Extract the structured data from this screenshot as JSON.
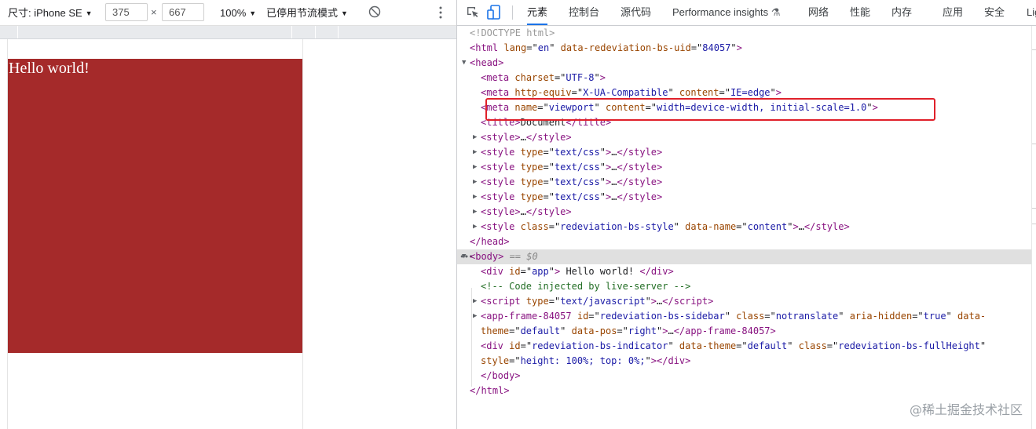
{
  "device_toolbar": {
    "dimensions_label": "尺寸: iPhone SE",
    "width_value": "375",
    "times_sign": "×",
    "height_value": "667",
    "zoom_label": "100%",
    "throttling_label": "已停用节流模式"
  },
  "page_preview": {
    "app_text": "Hello world!",
    "app_background": "#a52a2a"
  },
  "devtools": {
    "tabs": [
      "元素",
      "控制台",
      "源代码",
      "Performance insights",
      "网络",
      "性能",
      "内存",
      "应用",
      "安全",
      "Lig"
    ],
    "active_tab": "元素",
    "selected_line_suffix": "== $0"
  },
  "tree": {
    "doctype": "<!DOCTYPE html>",
    "html": {
      "tag": "html",
      "attrs": [
        [
          "lang",
          "en"
        ],
        [
          "data-redeviation-bs-uid",
          "84057"
        ]
      ]
    },
    "head_open": "<head>",
    "meta_charset": {
      "tag": "meta",
      "attrs": [
        [
          "charset",
          "UTF-8"
        ]
      ]
    },
    "meta_compat": {
      "tag": "meta",
      "attrs": [
        [
          "http-equiv",
          "X-UA-Compatible"
        ],
        [
          "content",
          "IE=edge"
        ]
      ]
    },
    "meta_viewport": {
      "tag": "meta",
      "attrs": [
        [
          "name",
          "viewport"
        ],
        [
          "content",
          "width=device-width, initial-scale=1.0"
        ]
      ]
    },
    "title": {
      "tag": "title",
      "text": "Document"
    },
    "style_plain": {
      "tag": "style",
      "collapsed": "…"
    },
    "style_css": {
      "tag": "style",
      "attrs": [
        [
          "type",
          "text/css"
        ]
      ],
      "collapsed": "…"
    },
    "style_content": {
      "tag": "style",
      "attrs": [
        [
          "class",
          "redeviation-bs-style"
        ],
        [
          "data-name",
          "content"
        ]
      ],
      "collapsed": "…"
    },
    "head_close": "</head>",
    "body_open": "<body>",
    "div_app": {
      "tag": "div",
      "attrs": [
        [
          "id",
          "app"
        ]
      ],
      "text": " Hello world! "
    },
    "comment": "<!-- Code injected by live-server -->",
    "script": {
      "tag": "script",
      "attrs": [
        [
          "type",
          "text/javascript"
        ]
      ],
      "collapsed": "…"
    },
    "app_frame": {
      "tag": "app-frame-84057",
      "attrs": [
        [
          "id",
          "redeviation-bs-sidebar"
        ],
        [
          "class",
          "notranslate"
        ],
        [
          "aria-hidden",
          "true"
        ],
        [
          "data-theme",
          "default"
        ],
        [
          "data-pos",
          "right"
        ]
      ],
      "collapsed": "…"
    },
    "indicator": {
      "tag": "div",
      "attrs": [
        [
          "id",
          "redeviation-bs-indicator"
        ],
        [
          "data-theme",
          "default"
        ],
        [
          "class",
          "redeviation-bs-fullHeight"
        ],
        [
          "style",
          "height: 100%; top: 0%;"
        ]
      ]
    },
    "body_close": "</body>",
    "html_close": "</html>"
  },
  "watermark": "@稀土掘金技术社区"
}
